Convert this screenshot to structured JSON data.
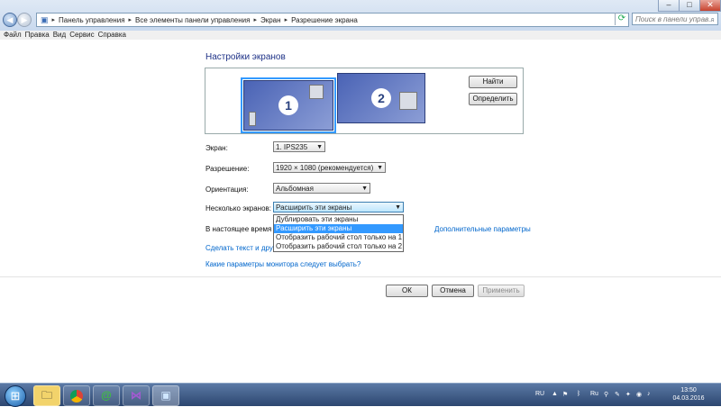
{
  "window": {
    "minimize": "–",
    "maximize": "□",
    "close": "✕"
  },
  "address": {
    "crumbs": [
      "Панель управления",
      "Все элементы панели управления",
      "Экран",
      "Разрешение экрана"
    ],
    "search_placeholder": "Поиск в панели управ..."
  },
  "menu": [
    "Файл",
    "Правка",
    "Вид",
    "Сервис",
    "Справка"
  ],
  "page": {
    "title": "Настройки экранов",
    "monitor1": "1",
    "monitor2": "2",
    "find_button": "Найти",
    "identify_button": "Определить",
    "fields": {
      "display": {
        "label": "Экран:",
        "value": "1. IPS235"
      },
      "resolution": {
        "label": "Разрешение:",
        "value": "1920 × 1080 (рекомендуется)"
      },
      "orientation": {
        "label": "Ориентация:",
        "value": "Альбомная"
      },
      "multiple": {
        "label": "Несколько экранов:",
        "value": "Расширить эти экраны"
      }
    },
    "dropdown_options": [
      "Дублировать эти экраны",
      "Расширить эти экраны",
      "Отобразить рабочий стол только на 1",
      "Отобразить рабочий стол только на 2"
    ],
    "dropdown_selected_index": 1,
    "current_text": "В настоящее время эт",
    "advanced_link": "Дополнительные параметры",
    "text_link": "Сделать текст и други",
    "monitor_link": "Какие параметры монитора следует выбрать?",
    "ok": "ОК",
    "cancel": "Отмена",
    "apply": "Применить"
  },
  "taskbar": {
    "lang": "RU",
    "time": "13:50",
    "date": "04.03.2016"
  },
  "colors": {
    "accent": "#3399ff",
    "link": "#0066cc",
    "title": "#1e3287"
  }
}
